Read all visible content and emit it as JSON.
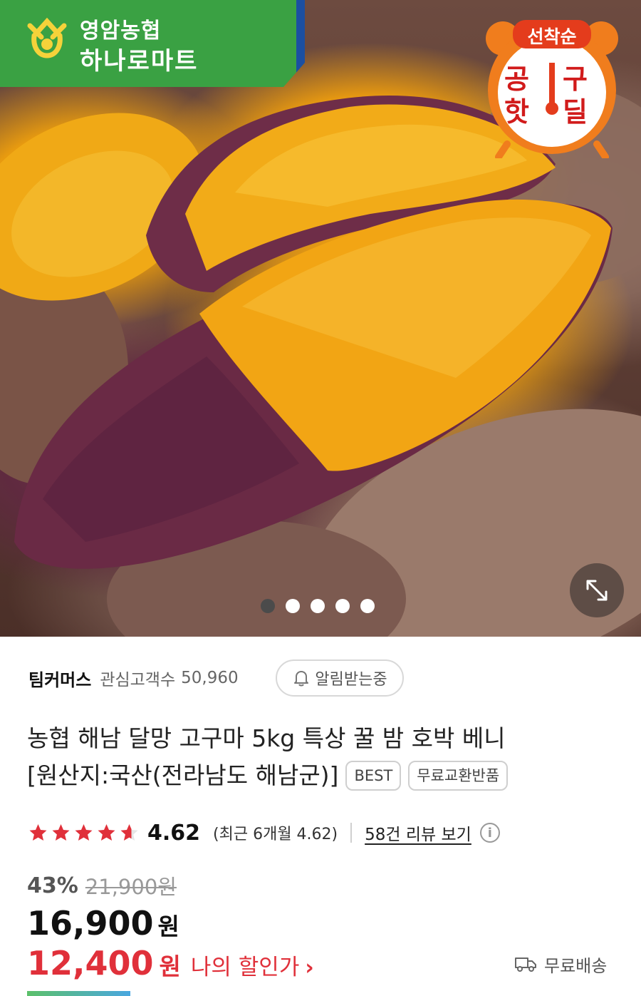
{
  "banner": {
    "brand_name": "영암농협",
    "brand_mart": "하나로마트",
    "brand_color": "#3aa143"
  },
  "deal_badge": {
    "top": "선착순",
    "l1": "공",
    "r1": "구",
    "l2": "핫",
    "r2": "딜",
    "color": "#d11b1b"
  },
  "gallery": {
    "image_count": 5,
    "active_index": 0,
    "expand_icon": "expand-arrows-icon"
  },
  "seller": {
    "name": "팀커머스",
    "fans_label": "관심고객수",
    "fans_count": "50,960",
    "notify_label": "알림받는중"
  },
  "product": {
    "title_line1": "농협 해남 달망 고구마 5kg 특상 꿀 밤 호박 베니",
    "title_line2": "[원산지:국산(전라남도 해남군)]",
    "tags": [
      "BEST",
      "무료교환반품"
    ]
  },
  "rating": {
    "value": "4.62",
    "stars": 4.62,
    "recent": "(최근 6개월 4.62)",
    "review_link": "58건 리뷰 보기",
    "star_color": "#e0303a"
  },
  "price": {
    "discount": "43%",
    "original": "21,900원",
    "sale": "16,900",
    "sale_unit": "원",
    "my_price": "12,400",
    "my_price_unit": "원",
    "my_price_label": "나의 할인가",
    "accent_color": "#e0303a"
  },
  "shipping": {
    "label": "무료배송",
    "icon": "truck-icon"
  }
}
